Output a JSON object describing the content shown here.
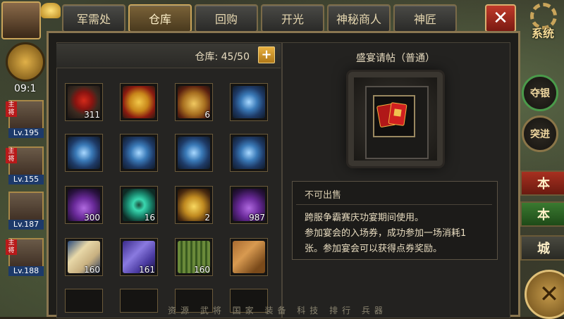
{
  "tabs": [
    {
      "label": "军需处"
    },
    {
      "label": "仓库"
    },
    {
      "label": "回购"
    },
    {
      "label": "开光"
    },
    {
      "label": "神秘商人"
    },
    {
      "label": "神匠"
    }
  ],
  "active_tab": "仓库",
  "top_right": {
    "system_label": "系统"
  },
  "warehouse": {
    "capacity_label": "仓库: 45/50",
    "add_button_label": "+",
    "slots": [
      {
        "count": "311",
        "icon": "red-pouch-on-plate-icon"
      },
      {
        "count": "",
        "icon": "gold-red-badge-icon"
      },
      {
        "count": "6",
        "icon": "gold-pouch-icon"
      },
      {
        "count": "",
        "icon": "blue-crest-emblem-icon"
      },
      {
        "count": "",
        "icon": "blue-crest-emblem-icon"
      },
      {
        "count": "",
        "icon": "blue-crest-emblem-icon"
      },
      {
        "count": "",
        "icon": "blue-crest-emblem-icon"
      },
      {
        "count": "",
        "icon": "blue-crest-emblem-icon"
      },
      {
        "count": "300",
        "icon": "purple-vase-icon"
      },
      {
        "count": "16",
        "icon": "jade-disc-icon"
      },
      {
        "count": "2",
        "icon": "golden-teapot-icon"
      },
      {
        "count": "987",
        "icon": "purple-vase-icon"
      },
      {
        "count": "160",
        "icon": "scroll-icon"
      },
      {
        "count": "161",
        "icon": "purple-book-icon"
      },
      {
        "count": "160",
        "icon": "green-bamboo-slips-icon"
      },
      {
        "count": "",
        "icon": "brown-book-icon"
      }
    ]
  },
  "detail": {
    "title": "盛宴请帖（普通）",
    "item_icon": "red-invitation-cards-icon",
    "tag": "不可出售",
    "desc_lines": [
      "跨服争霸赛庆功宴期间使用。",
      "参加宴会的入场券，成功参加一场消耗1",
      "张。参加宴会可以获得点券奖励。"
    ]
  },
  "heroes": [
    {
      "level": "Lv.195",
      "tag": "主将"
    },
    {
      "level": "Lv.155",
      "tag": "主将"
    },
    {
      "level": "Lv.187",
      "tag": ""
    },
    {
      "level": "Lv.188",
      "tag": "主将"
    }
  ],
  "time_text": "09:1",
  "right_buttons": [
    {
      "label": "夺银"
    },
    {
      "label": "突进"
    }
  ],
  "right_tiles": [
    {
      "label": "本"
    },
    {
      "label": "本"
    },
    {
      "label": "城"
    }
  ],
  "bottom_bar": "资源 武将 国家 装备 科技 排行 兵器",
  "colors": {
    "accent_gold": "#c9a45a",
    "close_red": "#c03a2a",
    "panel_border": "#8a7650"
  }
}
